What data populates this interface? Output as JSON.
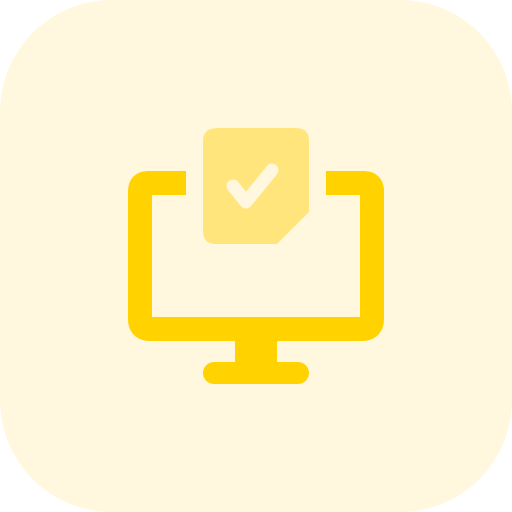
{
  "icon": {
    "name": "monitor-document-check-icon",
    "colors": {
      "tile_background": "#FFF7DE",
      "monitor": "#FFD200",
      "document": "#FFE57C",
      "checkmark": "#FFF7DE"
    }
  }
}
